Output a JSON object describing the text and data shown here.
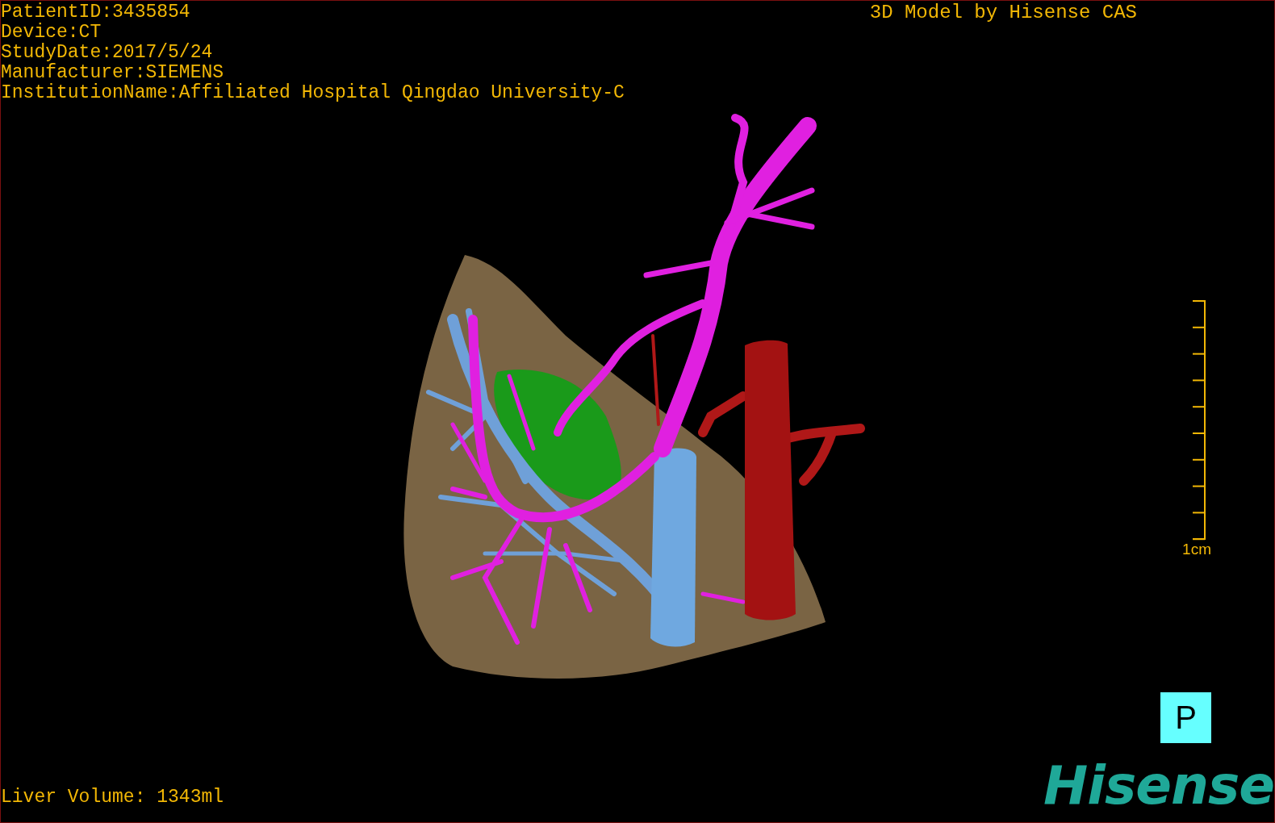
{
  "patient_info": [
    "PatientID:3435854",
    "Device:CT",
    "StudyDate:2017/5/24",
    "Manufacturer:SIEMENS",
    "InstitutionName:Affiliated Hospital Qingdao University-C"
  ],
  "title": "3D Model by Hisense CAS",
  "scale": {
    "label": "1cm"
  },
  "liver_volume": "Liver Volume: 1343ml",
  "orientation_marker": "P",
  "logo": "Hisense"
}
